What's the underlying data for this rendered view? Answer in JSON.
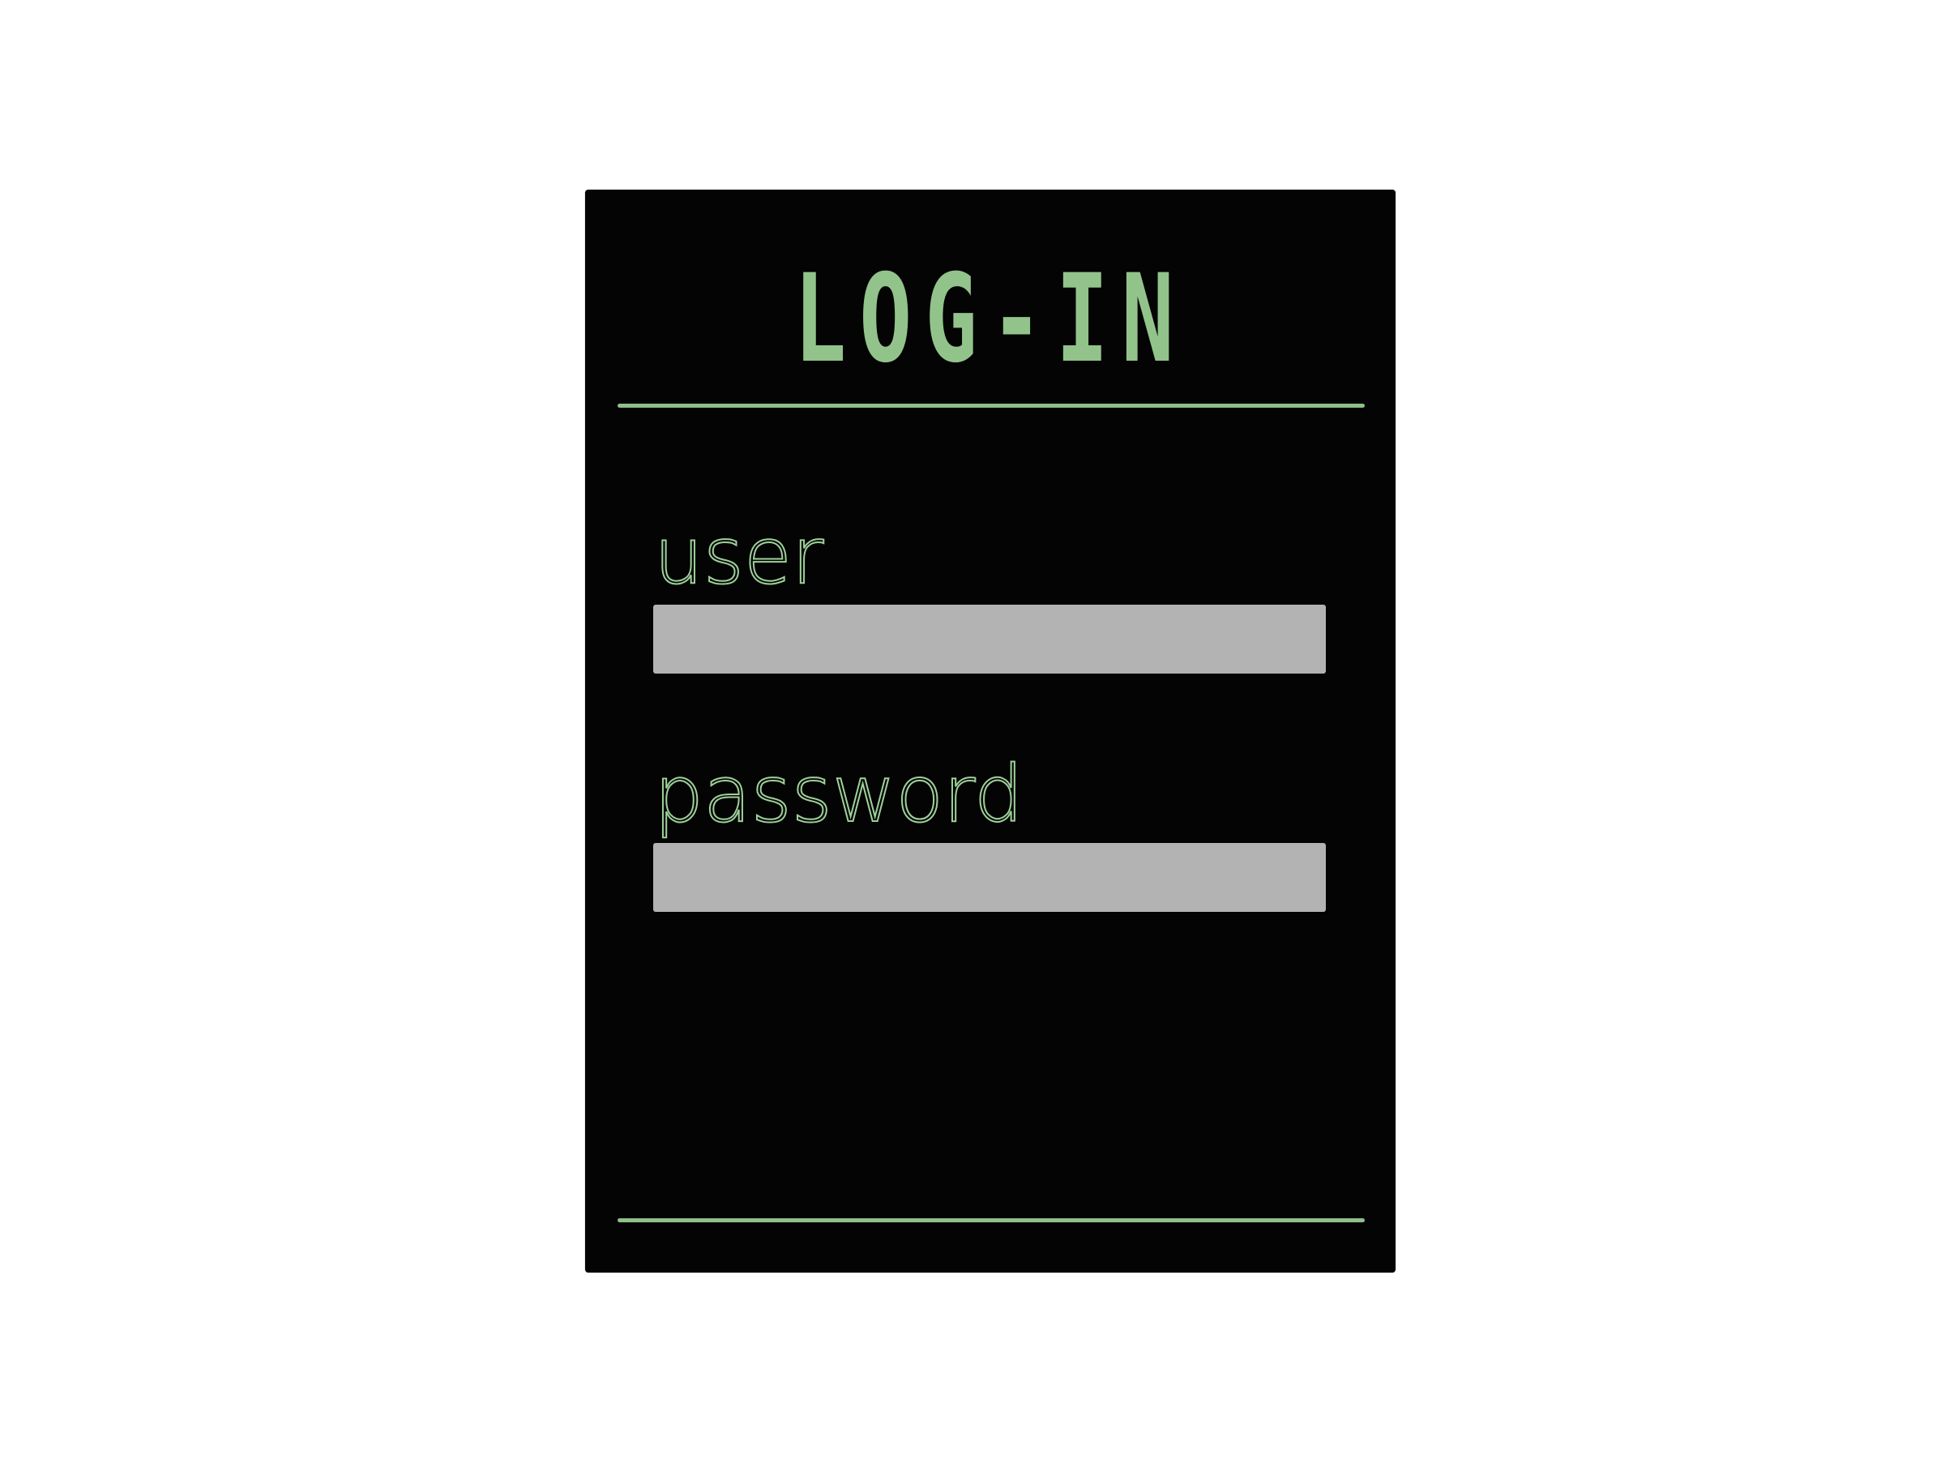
{
  "login": {
    "title": "LOG-IN",
    "user_label": "user",
    "user_value": "",
    "password_label": "password",
    "password_value": ""
  },
  "colors": {
    "accent": "#92c38b",
    "panel_background": "#040404",
    "input_background": "#b3b3b3",
    "page_background": "#ffffff"
  }
}
